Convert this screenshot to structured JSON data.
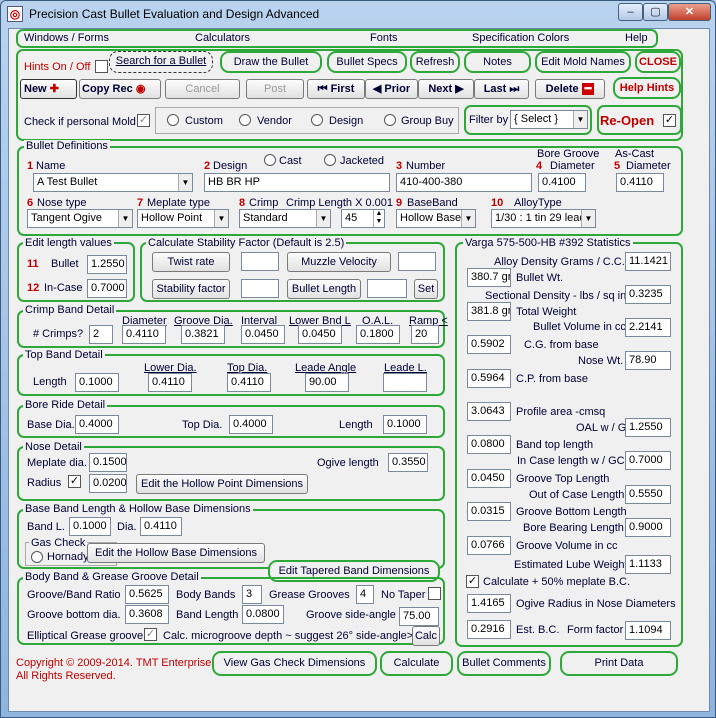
{
  "window": {
    "title": "Precision Cast Bullet Evaluation and Design Advanced",
    "min": "–",
    "max": "▢",
    "close": "✕"
  },
  "menu": {
    "windows": "Windows / Forms",
    "calculators": "Calculators",
    "fonts": "Fonts",
    "colors": "Specification Colors",
    "help": "Help"
  },
  "toolbar": {
    "hints": "Hints On / Off",
    "search": "Search for a Bullet",
    "draw": "Draw the Bullet",
    "specs": "Bullet Specs",
    "refresh": "Refresh",
    "notes": "Notes",
    "edit_mold": "Edit Mold Names",
    "close": "CLOSE",
    "new": "New",
    "copy_rec": "Copy Rec",
    "cancel": "Cancel",
    "post": "Post",
    "first": "First",
    "prior": "Prior",
    "next": "Next",
    "last": "Last",
    "delete": "Delete",
    "help_hints": "Help Hints",
    "personal_mold": "Check if personal Mold",
    "radio_custom": "Custom",
    "radio_vendor": "Vendor",
    "radio_design": "Design",
    "radio_group": "Group Buy",
    "filter_by": "Filter by",
    "filter_value": "{ Select }",
    "reopen": "Re-Open"
  },
  "bullet_def": {
    "legend": "Bullet Definitions",
    "n1": "1",
    "name_label": "Name",
    "name_value": "A Test Bullet",
    "n2": "2",
    "design_label": "Design",
    "design_value": "HB BR HP",
    "cast": "Cast",
    "jacketed": "Jacketed",
    "n3": "3",
    "number_label": "Number",
    "number_value": "410-400-380",
    "n4": "4",
    "bore_groove_label1": "Bore Groove",
    "bore_groove_label2": "Diameter",
    "bore_groove_value": "0.4100",
    "n5": "5",
    "ascast_label1": "As-Cast",
    "ascast_label2": "Diameter",
    "ascast_value": "0.4110",
    "n6": "6",
    "nose_type_label": "Nose type",
    "nose_type_value": "Tangent Ogive",
    "n7": "7",
    "meplate_type_label": "Meplate type",
    "meplate_type_value": "Hollow Point",
    "n8": "8",
    "crimp_label": "Crimp",
    "crimp_value": "Standard",
    "crimp_len_label": "Crimp Length X 0.001",
    "crimp_len_value": "45",
    "n9": "9",
    "baseband_label": "BaseBand",
    "baseband_value": "Hollow Base",
    "n10": "10",
    "alloy_label": "AlloyType",
    "alloy_value": "1/30 : 1 tin 29 lead"
  },
  "edit_length": {
    "legend": "Edit length values",
    "n11": "11",
    "bullet_label": "Bullet",
    "bullet_value": "1.2550",
    "n12": "12",
    "incase_label": "In-Case",
    "incase_value": "0.7000"
  },
  "stability": {
    "legend": "Calculate Stability  Factor (Default is 2.5)",
    "twist": "Twist rate",
    "muzzle": "Muzzle Velocity",
    "stab_factor": "Stability factor",
    "bullet_length": "Bullet Length",
    "set": "Set"
  },
  "crimp_band": {
    "legend": "Crimp Band Detail",
    "crimps_label": "# Crimps?",
    "crimps_value": "2",
    "diameter_label": "Diameter",
    "diameter_value": "0.4110",
    "groove_dia_label": "Groove Dia.",
    "groove_dia_value": "0.3821",
    "interval_label": "Interval",
    "interval_value": "0.0450",
    "lower_bnd_label": "Lower Bnd L",
    "lower_bnd_value": "0.0450",
    "oal_label": "O.A.L.",
    "oal_value": "0.1800",
    "ramp_label": "Ramp <",
    "ramp_value": "20"
  },
  "top_band": {
    "legend": "Top Band Detail",
    "length_label": "Length",
    "length_value": "0.1000",
    "lower_dia_label": "Lower Dia.",
    "lower_dia_value": "0.4110",
    "top_dia_label": "Top Dia.",
    "top_dia_value": "0.4110",
    "leade_angle_label": "Leade Angle",
    "leade_angle_value": "90.00",
    "leade_l_label": "Leade L."
  },
  "bore_ride": {
    "legend": "Bore Ride Detail",
    "base_dia_label": "Base Dia.",
    "base_dia_value": "0.4000",
    "top_dia_label": "Top Dia.",
    "top_dia_value": "0.4000",
    "length_label": "Length",
    "length_value": "0.1000"
  },
  "nose": {
    "legend": "Nose Detail",
    "meplate_label": "Meplate dia.",
    "meplate_value": "0.1500",
    "ogive_label": "Ogive length",
    "ogive_value": "0.3550",
    "radius_label": "Radius",
    "radius_value": "0.0200",
    "edit_hp": "Edit the Hollow Point Dimensions"
  },
  "base_band": {
    "legend": "Base Band Length & Hollow Base Dimensions",
    "bandl_label": "Band L.",
    "bandl_value": "0.1000",
    "dia_label": "Dia.",
    "dia_value": "0.4110",
    "gas_check": "Gas Check",
    "hornady": "Hornady",
    "edit_hb": "Edit the Hollow Base Dimensions",
    "edit_tapered": "Edit Tapered Band Dimensions"
  },
  "body_band": {
    "legend": "Body Band & Grease Groove Detail",
    "gbr_label": "Groove/Band Ratio",
    "gbr_value": "0.5625",
    "bands_label": "Body Bands",
    "bands_value": "3",
    "grooves_label": "Grease Grooves",
    "grooves_value": "4",
    "no_taper": "No Taper",
    "gbd_label": "Groove bottom dia.",
    "gbd_value": "0.3608",
    "band_len_label": "Band Length",
    "band_len_value": "0.0800",
    "side_angle_label": "Groove side-angle",
    "side_angle_value": "75.00",
    "elliptical": "Elliptical Grease groove",
    "microgroove": "Calc. microgroove depth ~ suggest 26° side-angle>",
    "calc": "Calc"
  },
  "varga": {
    "legend": "Varga 575-500-HB #392 Statistics",
    "alloy_density_label": "Alloy Density Grams / C.C.",
    "alloy_density_value": "11.1421",
    "bullet_wt_value": "380.7 gr",
    "bullet_wt_label": "Bullet Wt.",
    "sect_density_label": "Sectional Density - lbs / sq in",
    "sect_density_value": "0.3235",
    "total_wt_value": "381.8 gr",
    "total_wt_label": "Total  Weight",
    "volume_label": "Bullet Volume in cc",
    "volume_value": "2.2141",
    "cg_value": "0.5902",
    "cg_label": "C.G. from base",
    "nose_wt_label": "Nose Wt.",
    "nose_wt_value": "78.90",
    "cp_value": "0.5964",
    "cp_label": "C.P. from base",
    "profile_value": "3.0643",
    "profile_label": "Profile area -cmsq",
    "oal_gc_label": "OAL w / GC",
    "oal_gc_value": "1.2550",
    "band_top_value": "0.0800",
    "band_top_label": "Band top length",
    "incase_gc_label": "In Case length w / GC",
    "incase_gc_value": "0.7000",
    "groove_top_value": "0.0450",
    "groove_top_label": "Groove Top Length",
    "out_case_label": "Out of Case Length",
    "out_case_value": "0.5550",
    "groove_bottom_value": "0.0315",
    "groove_bottom_label": "Groove Bottom Length",
    "bearing_label": "Bore Bearing Length",
    "bearing_value": "0.9000",
    "groove_vol_value": "0.0766",
    "groove_vol_label": "Groove Volume in cc",
    "lube_label": "Estimated Lube Weight",
    "lube_value": "1.1133",
    "calc_meplate": "Calculate + 50% meplate B.C.",
    "ogive_radius_value": "1.4165",
    "ogive_radius_label": "Ogive Radius in Nose Diameters",
    "bc_value": "0.2916",
    "bc_label": "Est. B.C.",
    "form_label": "Form factor",
    "form_value": "1.1094"
  },
  "footer": {
    "copyright": "Copyright © 2009-2014. TMT Enterprises",
    "rights": "All Rights Reserved.",
    "gas_check_dims": "View Gas Check Dimensions",
    "calculate": "Calculate",
    "comments": "Bullet Comments",
    "print": "Print Data"
  }
}
